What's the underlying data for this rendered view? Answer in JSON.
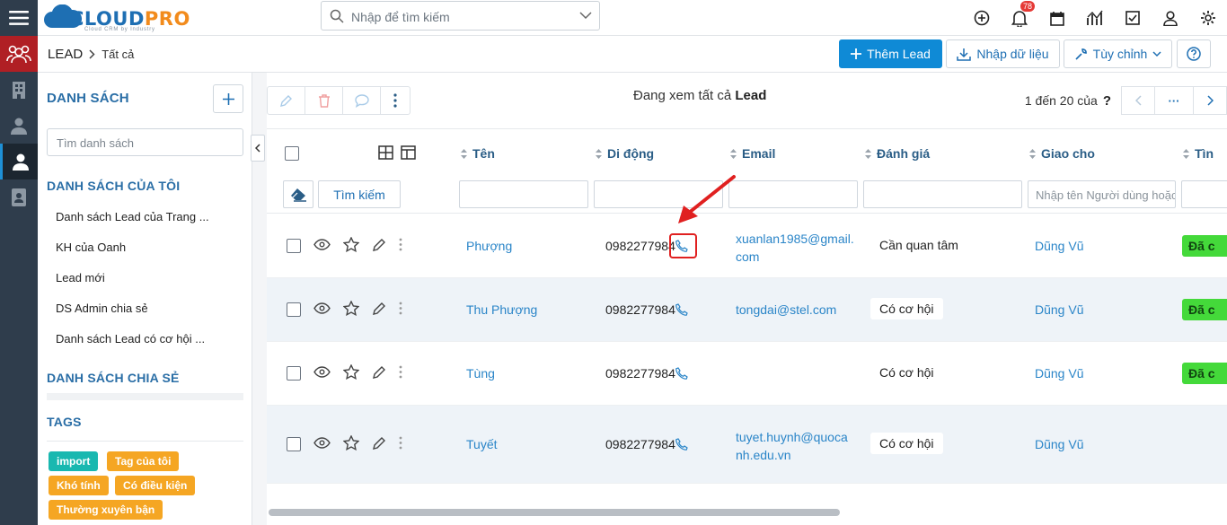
{
  "logo": {
    "brand_a": "CLOUD",
    "brand_b": "PRO",
    "tagline": "Cloud CRM by Industry"
  },
  "search": {
    "placeholder": "Nhập để tìm kiếm"
  },
  "notifications": {
    "count": "78"
  },
  "breadcrumb": {
    "module": "LEAD",
    "view": "Tất cả"
  },
  "actions": {
    "add": "Thêm Lead",
    "import": "Nhập dữ liệu",
    "customize": "Tùy chỉnh"
  },
  "sidebar": {
    "title": "DANH SÁCH",
    "search_placeholder": "Tìm danh sách",
    "my_lists_title": "DANH SÁCH CỦA TÔI",
    "my_lists": [
      "Danh sách Lead của Trang ...",
      "KH của Oanh",
      "Lead mới",
      "DS Admin chia sẻ",
      "Danh sách Lead có cơ hội ..."
    ],
    "shared_title": "DANH SÁCH CHIA SẺ",
    "tags_title": "TAGS",
    "tags": [
      {
        "label": "import",
        "color": "#19b8b0"
      },
      {
        "label": "Tag của tôi",
        "color": "#f5a623"
      },
      {
        "label": "Khó tính",
        "color": "#f5a623"
      },
      {
        "label": "Có điều kiện",
        "color": "#f5a623"
      },
      {
        "label": "Thường xuyên bận",
        "color": "#f5a623"
      }
    ]
  },
  "viewing": {
    "prefix": "Đang xem tất cả",
    "entity": "Lead"
  },
  "pager": {
    "range": "1 đến 20 của",
    "unknown": "?",
    "more": "···"
  },
  "columns": {
    "name": "Tên",
    "mobile": "Di động",
    "email": "Email",
    "rating": "Đánh giá",
    "assigned": "Giao cho",
    "status": "Tìn"
  },
  "filters": {
    "search_button": "Tìm kiếm",
    "assigned_placeholder": "Nhập tên Người dùng hoặc nhóm"
  },
  "rows": [
    {
      "name": "Phượng",
      "mobile": "0982277984",
      "email_l1": "xuanlan1985@gmail.",
      "email_l2": "com",
      "rating": "Cần quan tâm",
      "assigned": "Dũng Vũ",
      "status": "Đã c"
    },
    {
      "name": "Thu Phượng",
      "mobile": "0982277984",
      "email_l1": "tongdai@stel.com",
      "email_l2": "",
      "rating": "Có cơ hội",
      "assigned": "Dũng Vũ",
      "status": "Đã c"
    },
    {
      "name": "Tùng",
      "mobile": "0982277984",
      "email_l1": "",
      "email_l2": "",
      "rating": "Có cơ hội",
      "assigned": "Dũng Vũ",
      "status": "Đã c"
    },
    {
      "name": "Tuyết",
      "mobile": "0982277984",
      "email_l1": "tuyet.huynh@quoca",
      "email_l2": "nh.edu.vn",
      "rating": "Có cơ hội",
      "assigned": "Dũng Vũ",
      "status": ""
    }
  ],
  "colors": {
    "primary": "#0f8ad6",
    "link": "#2a85c8",
    "status_green": "#44d93a",
    "highlight_red": "#e02020"
  }
}
